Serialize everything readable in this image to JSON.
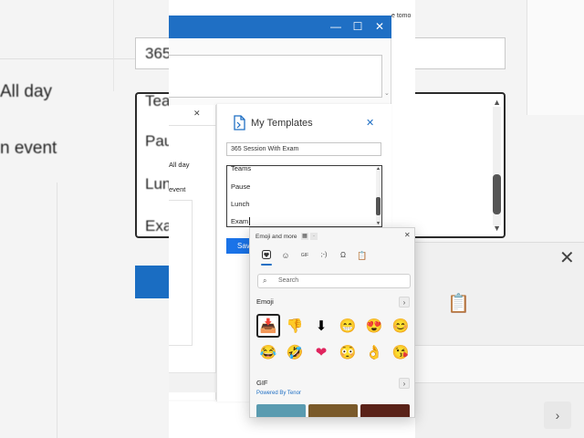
{
  "background": {
    "left_items": [
      "All day",
      "n event"
    ],
    "right_field_text": "365",
    "right_lines": [
      "Teams",
      "Paus",
      "Lun",
      "Exa"
    ],
    "top_right_text": "e tomo"
  },
  "event_window": {
    "allday_label": "All day",
    "event_label": "event"
  },
  "templates": {
    "title": "My Templates",
    "template_name": "365 Session With Exam",
    "lines": [
      "Teams",
      "Pause",
      "Lunch",
      "Exam"
    ],
    "save_label": "Save"
  },
  "emoji_picker": {
    "title": "Emoji and more",
    "search_placeholder": "Search",
    "section_emoji": "Emoji",
    "section_gif": "GIF",
    "tenor_label": "Powered By Tenor",
    "tabs": [
      {
        "name": "heart-emoji-tab-icon",
        "glyph": "❤"
      },
      {
        "name": "smiley-tab-icon",
        "glyph": "☺"
      },
      {
        "name": "gif-tab-icon",
        "glyph": "GIF"
      },
      {
        "name": "kaomoji-tab-icon",
        "glyph": ";-)"
      },
      {
        "name": "symbols-tab-icon",
        "glyph": "Ω"
      },
      {
        "name": "clipboard-tab-icon",
        "glyph": "📋"
      }
    ],
    "emoji_rows": [
      [
        "📥",
        "👎",
        "⬇",
        "😁",
        "😍",
        "😊"
      ],
      [
        "😂",
        "🤣",
        "❤",
        "😳",
        "👌",
        "😘"
      ]
    ],
    "gif_colors": [
      "#5a9bb0",
      "#7a5a2a",
      "#5a2218"
    ]
  },
  "colors": {
    "accent": "#1f6fc4",
    "save": "#1a73e8",
    "tenor": "#1f6fc4"
  }
}
